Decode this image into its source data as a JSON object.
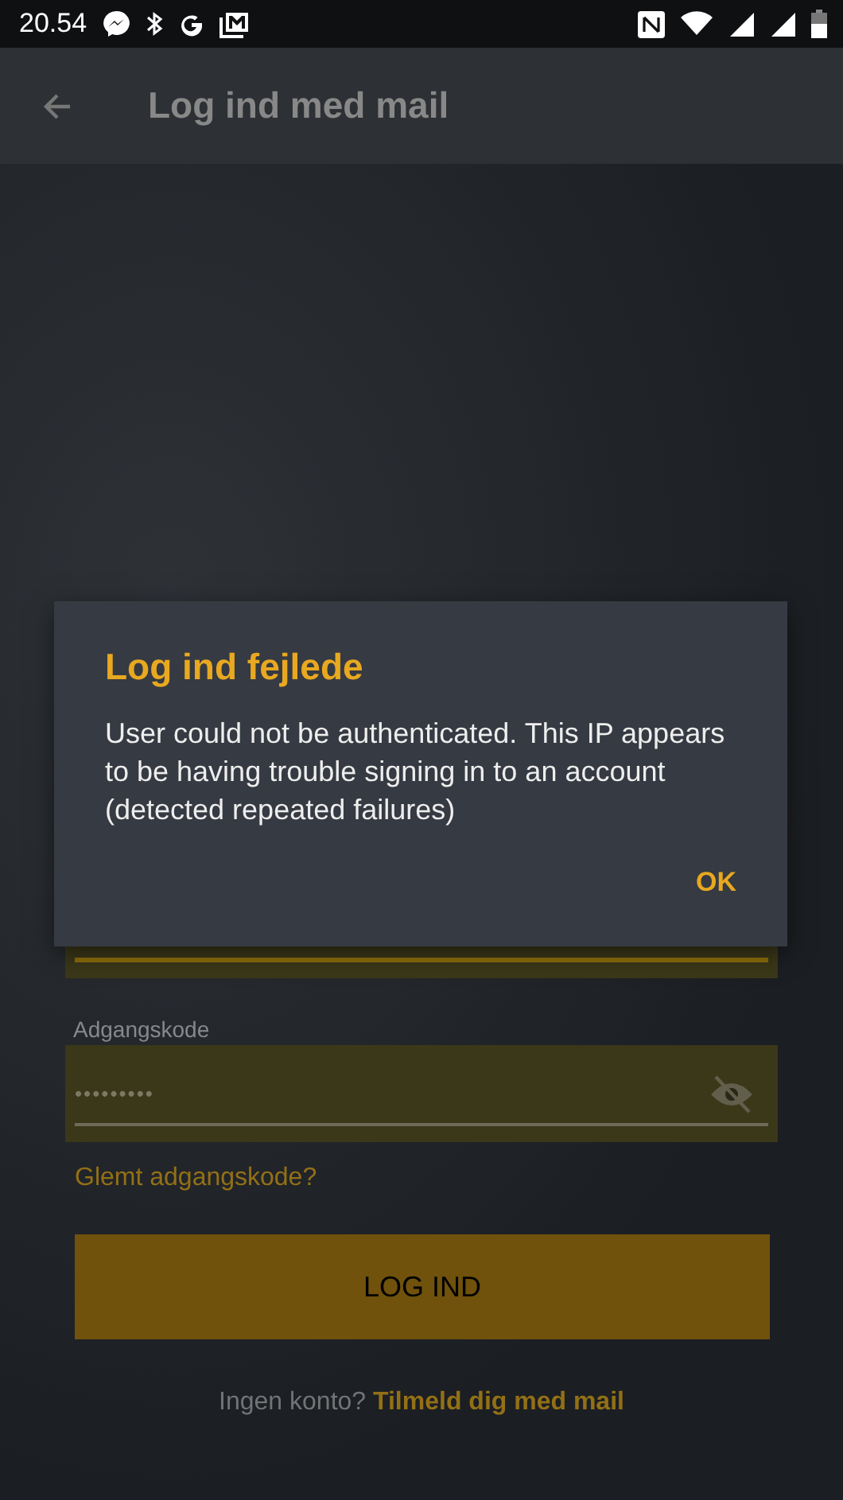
{
  "status_bar": {
    "time": "20.54"
  },
  "app_bar": {
    "title": "Log ind med mail"
  },
  "form": {
    "password_label": "Adgangskode",
    "password_value": "•••••••••",
    "password_visible": false,
    "forgot_link": "Glemt adgangskode?",
    "submit": "LOG IND",
    "footer_text": "Ingen konto?",
    "signup_link": "Tilmeld dig med mail"
  },
  "dialog": {
    "title": "Log ind fejlede",
    "message": "User could not be authenticated. This IP appears to be having trouble signing in to an account (detected repeated failures)",
    "buttons": [
      "OK"
    ]
  }
}
